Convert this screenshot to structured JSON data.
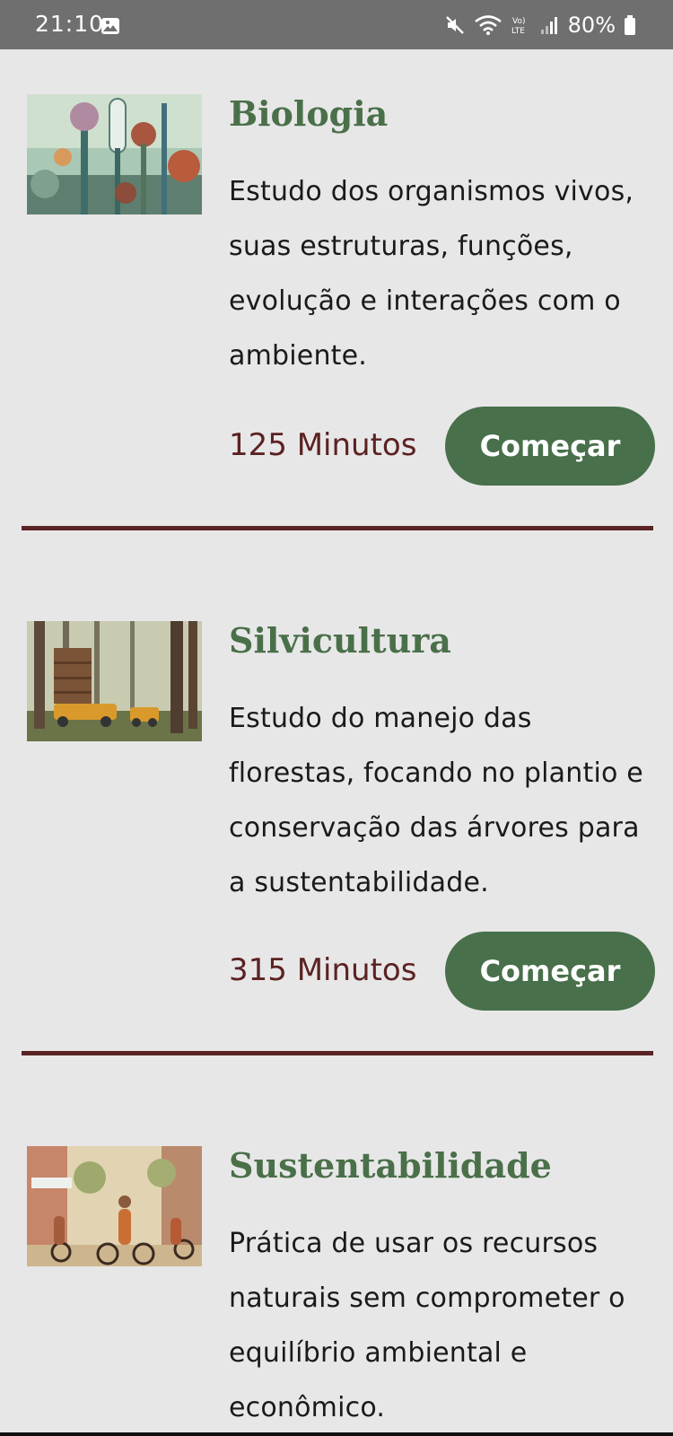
{
  "status_bar": {
    "time": "21:10",
    "battery_percent": "80%",
    "icons": [
      "gallery-icon",
      "mute-icon",
      "wifi-icon",
      "volte-icon",
      "signal-icon",
      "battery-icon"
    ]
  },
  "courses": [
    {
      "title": "Biologia",
      "description": "Estudo dos organismos vivos, suas estruturas, funções, evolução e interações com o ambiente.",
      "duration": "125 Minutos",
      "button_label": "Começar"
    },
    {
      "title": "Silvicultura",
      "description": "Estudo do manejo das florestas, focando no plantio e conservação das árvores para a sustentabilidade.",
      "duration": "315 Minutos",
      "button_label": "Começar"
    },
    {
      "title": "Sustentabilidade",
      "description": "Prática de usar os recursos naturais sem comprometer o equilíbrio ambiental e econômico."
    }
  ],
  "colors": {
    "background": "#e8e7e8",
    "title_green": "#4a7049",
    "button_green": "#48704a",
    "duration_maroon": "#5b2222",
    "divider_maroon": "#5a2424",
    "status_bar": "#6f6f6f"
  }
}
